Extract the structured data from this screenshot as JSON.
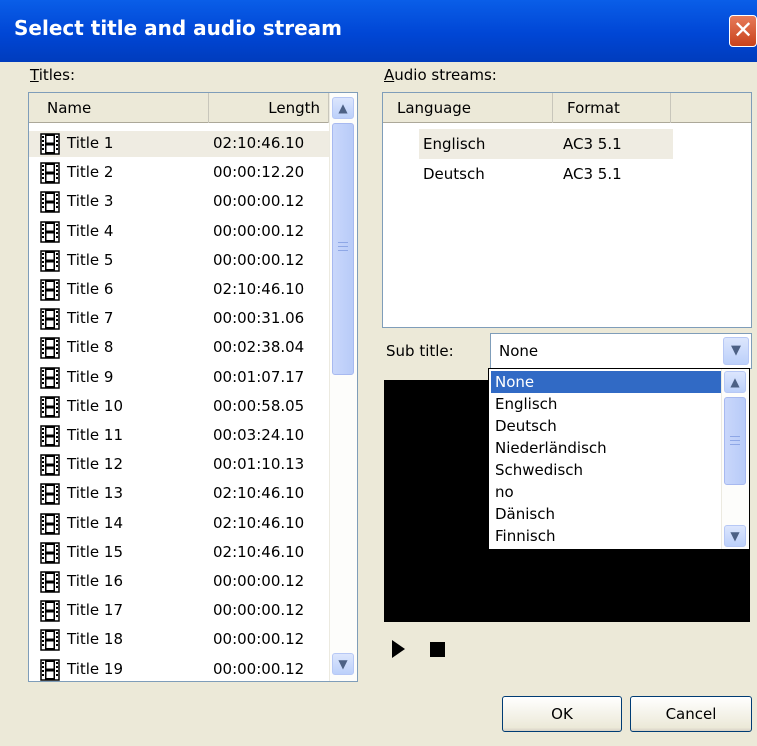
{
  "window": {
    "title": "Select title and audio stream",
    "close": "✕"
  },
  "titles": {
    "label": "Titles:",
    "columns": {
      "name": "Name",
      "length": "Length"
    },
    "rows": [
      {
        "name": "Title 1",
        "length": "02:10:46.10"
      },
      {
        "name": "Title 2",
        "length": "00:00:12.20"
      },
      {
        "name": "Title 3",
        "length": "00:00:00.12"
      },
      {
        "name": "Title 4",
        "length": "00:00:00.12"
      },
      {
        "name": "Title 5",
        "length": "00:00:00.12"
      },
      {
        "name": "Title 6",
        "length": "02:10:46.10"
      },
      {
        "name": "Title 7",
        "length": "00:00:31.06"
      },
      {
        "name": "Title 8",
        "length": "00:02:38.04"
      },
      {
        "name": "Title 9",
        "length": "00:01:07.17"
      },
      {
        "name": "Title 10",
        "length": "00:00:58.05"
      },
      {
        "name": "Title 11",
        "length": "00:03:24.10"
      },
      {
        "name": "Title 12",
        "length": "00:01:10.13"
      },
      {
        "name": "Title 13",
        "length": "02:10:46.10"
      },
      {
        "name": "Title 14",
        "length": "02:10:46.10"
      },
      {
        "name": "Title 15",
        "length": "02:10:46.10"
      },
      {
        "name": "Title 16",
        "length": "00:00:00.12"
      },
      {
        "name": "Title 17",
        "length": "00:00:00.12"
      },
      {
        "name": "Title 18",
        "length": "00:00:00.12"
      },
      {
        "name": "Title 19",
        "length": "00:00:00.12"
      }
    ],
    "selected_index": 0
  },
  "audio": {
    "label": "Audio streams:",
    "columns": {
      "language": "Language",
      "format": "Format"
    },
    "rows": [
      {
        "language": "Englisch",
        "format": "AC3 5.1"
      },
      {
        "language": "Deutsch",
        "format": "AC3 5.1"
      }
    ]
  },
  "subtitle": {
    "label": "Sub title:",
    "value": "None",
    "options": [
      "None",
      "Englisch",
      "Deutsch",
      "Niederländisch",
      "Schwedisch",
      "no",
      "Dänisch",
      "Finnisch"
    ],
    "highlighted": "None"
  },
  "buttons": {
    "ok": "OK",
    "cancel": "Cancel"
  },
  "colors": {
    "titlebar": "#0046d5",
    "highlight": "#316ac5",
    "dialog_bg": "#ece9d8"
  }
}
